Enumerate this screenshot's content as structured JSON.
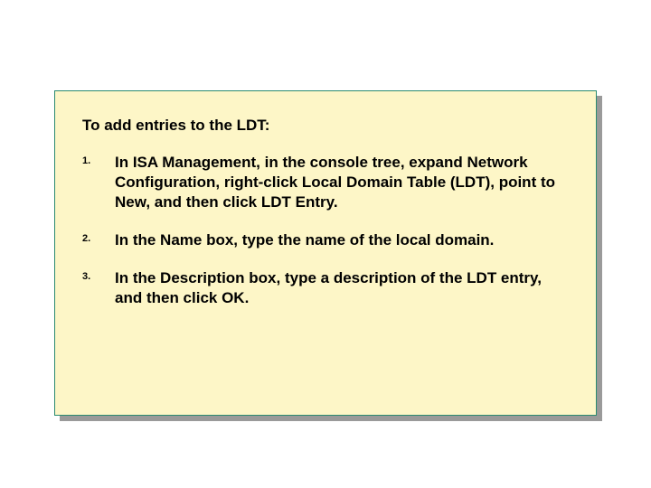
{
  "heading": "To add entries to the LDT:",
  "steps": [
    {
      "number": "1.",
      "text": "In ISA Management, in the console tree, expand Network Configuration, right-click Local Domain Table (LDT), point to New, and then click LDT Entry."
    },
    {
      "number": "2.",
      "text": "In the Name box, type the name of the local domain."
    },
    {
      "number": "3.",
      "text": "In the Description box, type a description of the LDT entry, and then click OK."
    }
  ]
}
